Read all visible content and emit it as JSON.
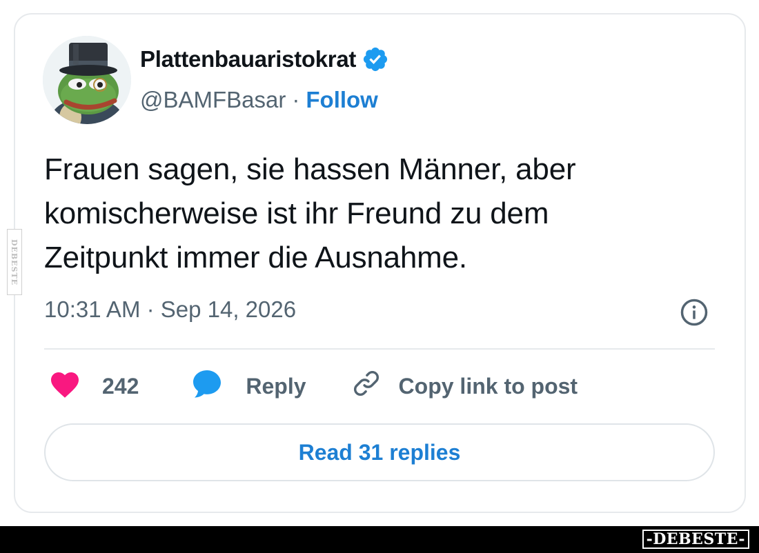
{
  "tweet": {
    "author": {
      "display_name": "Plattenbauaristokrat",
      "handle": "@BAMFBasar",
      "verified": true,
      "avatar_icon": "frog-with-top-hat-avatar"
    },
    "separator": "·",
    "follow_label": "Follow",
    "text_lines": [
      "Frauen sagen, sie hassen Männer, aber",
      "komischerweise ist ihr Freund zu dem",
      "Zeitpunkt immer die Ausnahme."
    ],
    "timestamp": "10:31 AM · Sep 14, 2026",
    "actions": {
      "like_count": "242",
      "reply_label": "Reply",
      "copy_link_label": "Copy link to post"
    },
    "read_replies_label": "Read 31 replies"
  },
  "watermark": {
    "side": "DEBESTE",
    "footer": "-DEBESTE-"
  },
  "colors": {
    "accent": "#1d7fd3",
    "verified": "#1d9bf0",
    "like": "#f91880",
    "reply_icon": "#1d9bf0",
    "text": "#0f1419",
    "muted": "#536471"
  }
}
